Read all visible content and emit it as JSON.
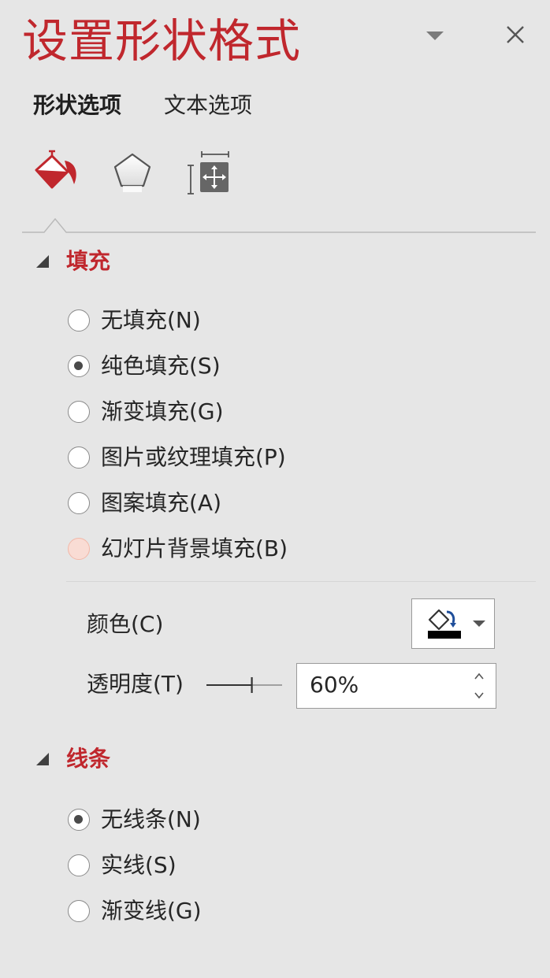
{
  "pane": {
    "title": "设置形状格式"
  },
  "tabs": {
    "shape_options": "形状选项",
    "text_options": "文本选项"
  },
  "colors": {
    "accent": "#c0272d",
    "background": "#e6e6e6",
    "radio_hover": "#f9dcd4"
  },
  "icons": {
    "menu": "chevron-down-icon",
    "close": "close-icon",
    "fill_line": "paint-bucket-icon",
    "effects": "pentagon-icon",
    "size_properties": "size-properties-icon"
  },
  "fill": {
    "header": "填充",
    "options": [
      {
        "label": "无填充(N)",
        "checked": false
      },
      {
        "label": "纯色填充(S)",
        "checked": true
      },
      {
        "label": "渐变填充(G)",
        "checked": false
      },
      {
        "label": "图片或纹理填充(P)",
        "checked": false
      },
      {
        "label": "图案填充(A)",
        "checked": false
      },
      {
        "label": "幻灯片背景填充(B)",
        "checked": false,
        "hovered": true
      }
    ],
    "color_label": "颜色(C)",
    "color_value": "#000000",
    "transparency_label": "透明度(T)",
    "transparency_value": "60%",
    "transparency_fraction": 0.6
  },
  "line": {
    "header": "线条",
    "options": [
      {
        "label": "无线条(N)",
        "checked": true
      },
      {
        "label": "实线(S)",
        "checked": false
      },
      {
        "label": "渐变线(G)",
        "checked": false
      }
    ]
  }
}
